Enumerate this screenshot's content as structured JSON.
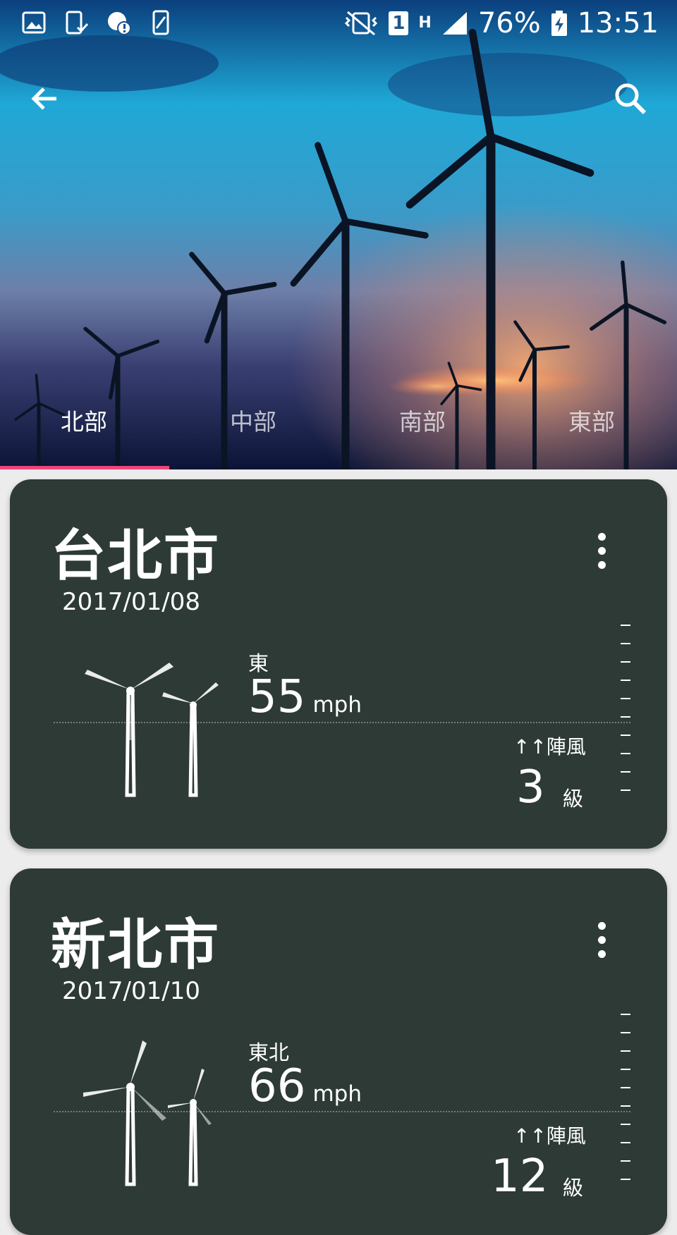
{
  "status": {
    "battery": "76%",
    "time": "13:51",
    "sim": "1",
    "net": "H",
    "icons": [
      "image-icon",
      "phone-check-icon",
      "chat-alert-icon",
      "device-icon",
      "vibrate-icon",
      "sim-icon",
      "network-h-icon",
      "signal-icon",
      "charging-icon"
    ]
  },
  "toolbar": {
    "back_icon": "arrow-left-icon",
    "search_icon": "search-icon"
  },
  "tabs": [
    {
      "label": "北部",
      "active": true
    },
    {
      "label": "中部",
      "active": false
    },
    {
      "label": "南部",
      "active": false
    },
    {
      "label": "東部",
      "active": false
    }
  ],
  "colors": {
    "card": "#2d3a35",
    "indicator": "#f0457a",
    "background": "#ececec"
  },
  "cards": [
    {
      "city": "台北市",
      "date": "2017/01/08",
      "direction": "東",
      "speed": "55",
      "unit": "mph",
      "gust_label": "↑↑陣風",
      "level": "3",
      "level_unit": "級"
    },
    {
      "city": "新北市",
      "date": "2017/01/10",
      "direction": "東北",
      "speed": "66",
      "unit": "mph",
      "gust_label": "↑↑陣風",
      "level": "12",
      "level_unit": "級"
    }
  ]
}
